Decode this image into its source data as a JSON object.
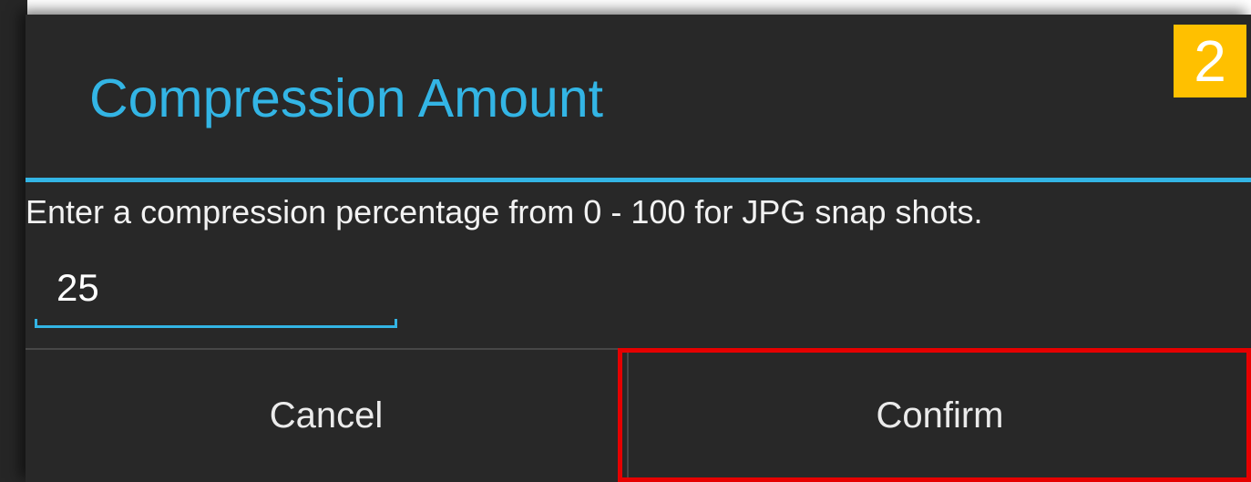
{
  "dialog": {
    "title": "Compression Amount",
    "message": "Enter a compression percentage from 0 - 100 for JPG snap shots.",
    "input": {
      "value": "25"
    },
    "buttons": {
      "cancel_label": "Cancel",
      "confirm_label": "Confirm"
    }
  },
  "annotation": {
    "step_number": "2",
    "highlighted_target": "confirm-button"
  },
  "colors": {
    "dialog_background": "#282828",
    "accent": "#33b5e5",
    "badge": "#ffc000",
    "highlight": "#e60000",
    "text": "#f2f2f2"
  },
  "icons": []
}
